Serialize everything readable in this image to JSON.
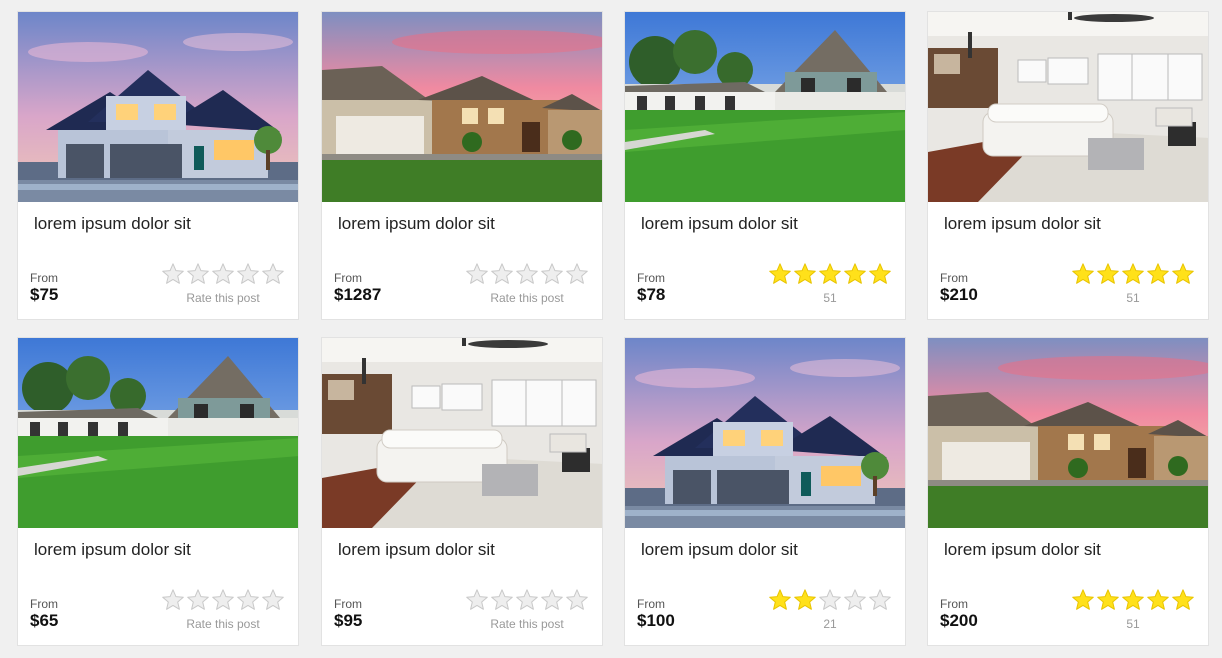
{
  "listings": [
    {
      "title": "lorem ipsum dolor sit",
      "from_label": "From",
      "price": "$75",
      "rating": 0,
      "rating_caption": "Rate this post",
      "photo": "house-twilight"
    },
    {
      "title": "lorem ipsum dolor sit",
      "from_label": "From",
      "price": "$1287",
      "rating": 0,
      "rating_caption": "Rate this post",
      "photo": "house-sunset"
    },
    {
      "title": "lorem ipsum dolor sit",
      "from_label": "From",
      "price": "$78",
      "rating": 5,
      "rating_caption": "51",
      "photo": "house-lawn"
    },
    {
      "title": "lorem ipsum dolor sit",
      "from_label": "From",
      "price": "$210",
      "rating": 5,
      "rating_caption": "51",
      "photo": "living-room"
    },
    {
      "title": "lorem ipsum dolor sit",
      "from_label": "From",
      "price": "$65",
      "rating": 0,
      "rating_caption": "Rate this post",
      "photo": "house-lawn"
    },
    {
      "title": "lorem ipsum dolor sit",
      "from_label": "From",
      "price": "$95",
      "rating": 0,
      "rating_caption": "Rate this post",
      "photo": "living-room"
    },
    {
      "title": "lorem ipsum dolor sit",
      "from_label": "From",
      "price": "$100",
      "rating": 2,
      "rating_caption": "21",
      "photo": "house-twilight"
    },
    {
      "title": "lorem ipsum dolor sit",
      "from_label": "From",
      "price": "$200",
      "rating": 5,
      "rating_caption": "51",
      "photo": "house-sunset"
    }
  ],
  "colors": {
    "star_filled": "#ffe11a",
    "star_filled_stroke": "#e8c400",
    "star_empty": "#eeeeee",
    "star_empty_stroke": "#c8c8c8"
  }
}
